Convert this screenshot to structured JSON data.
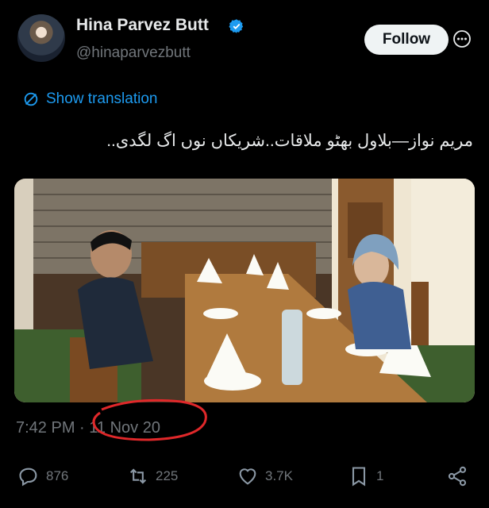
{
  "author": {
    "name": "Hina Parvez Butt",
    "handle": "@hinaparvezbutt",
    "follow_label": "Follow"
  },
  "translate": {
    "label": "Show translation"
  },
  "tweet": {
    "text": "مریم نواز—بلاول بھٹو ملاقات..شریکاں نوں اگ لگدی..",
    "time": "7:42 PM",
    "separator": "·",
    "date": "11 Nov 20"
  },
  "metrics": {
    "replies": "876",
    "retweets": "225",
    "likes": "3.7K",
    "bookmarks": "1"
  },
  "colors": {
    "accent": "#1d9bf0",
    "annotation": "#e0282a"
  }
}
